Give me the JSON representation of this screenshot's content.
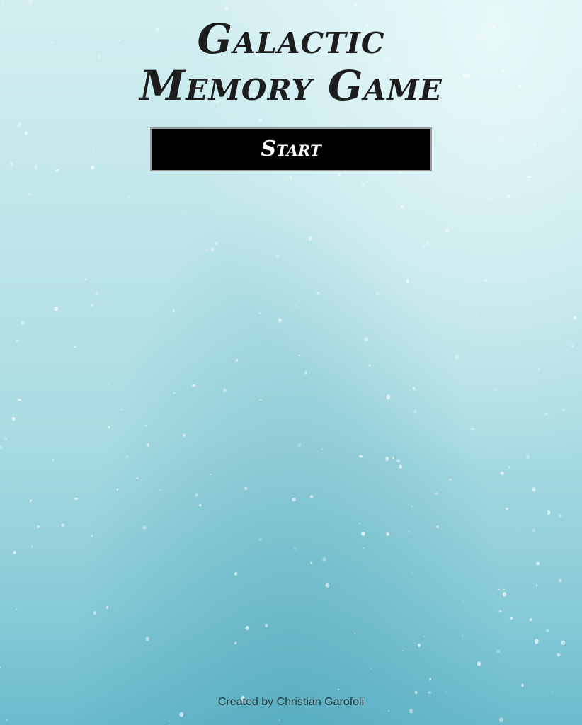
{
  "title": {
    "line1": "Galactic",
    "line2": "Memory Game"
  },
  "controls": {
    "start_label": "Start"
  },
  "footer": {
    "credit": "Created by Christian Garofoli"
  },
  "colors": {
    "background_top": "#d2eef0",
    "background_bottom": "#6bbbcd",
    "title_text": "#1d1d1d",
    "button_bg": "#000000",
    "button_text": "#ffffff"
  }
}
